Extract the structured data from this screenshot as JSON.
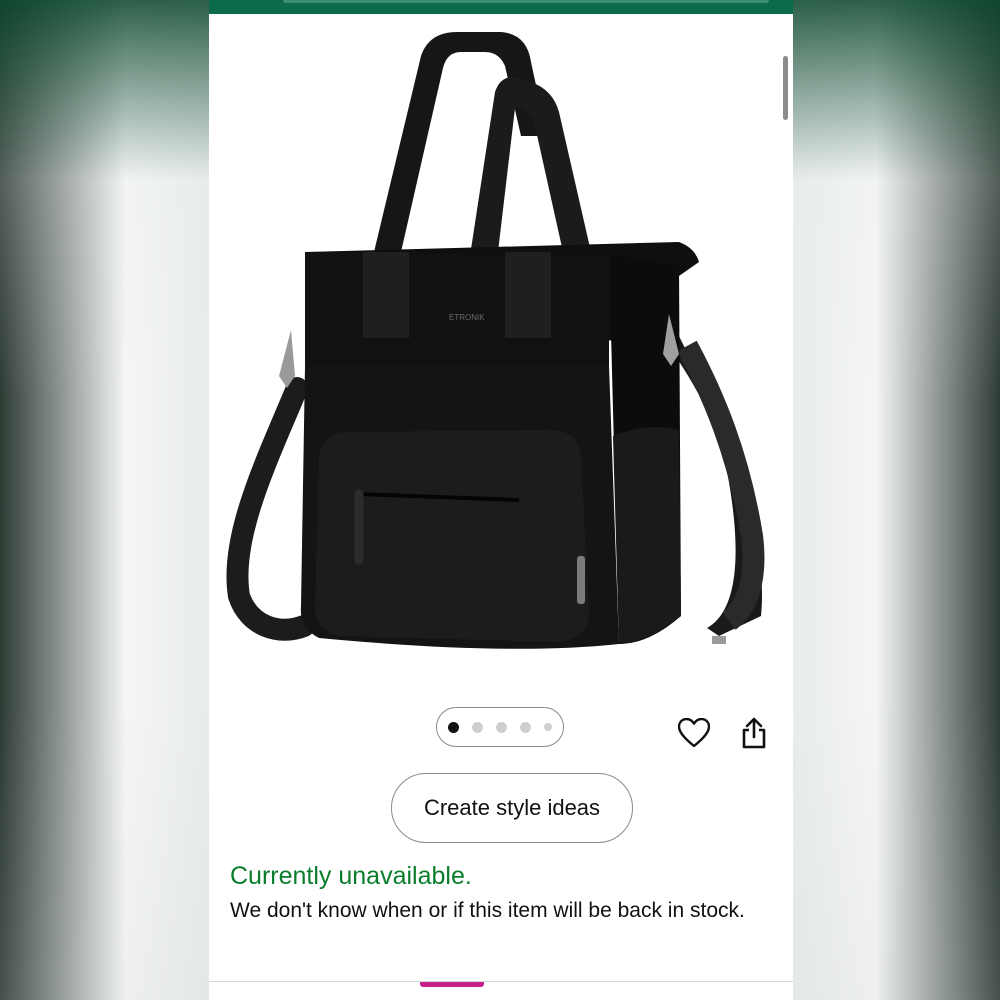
{
  "product": {
    "image_icon": "tote-bag-image",
    "brand_mark": "ETRONIK",
    "image_count": 5,
    "current_image_index": 1
  },
  "actions": {
    "wishlist_icon": "heart-icon",
    "share_icon": "share-icon",
    "style_button_label": "Create style ideas"
  },
  "availability": {
    "status": "Currently unavailable.",
    "status_color": "#0a7d2c",
    "message": "We don't know when or if this item will be back in stock."
  },
  "colors": {
    "topbar": "#0c6b4a",
    "bottom_accent": "#c91f8b"
  }
}
